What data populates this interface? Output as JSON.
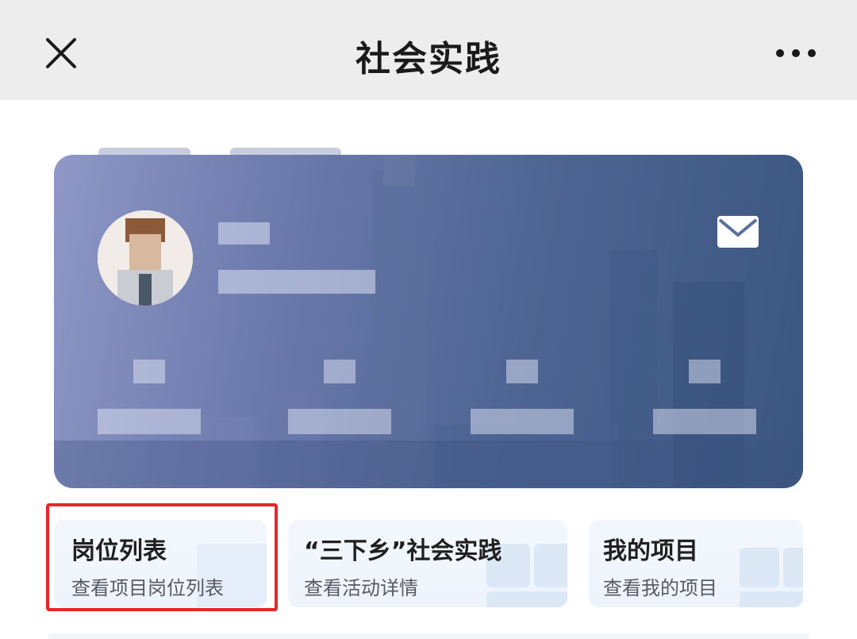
{
  "navbar": {
    "title": "社会实践",
    "close_icon": "close-icon",
    "more_icon": "more-dots-icon"
  },
  "banner": {
    "mail_icon": "envelope-icon",
    "colors": {
      "gradient_start": "#8f98c6",
      "gradient_end": "#3a5680"
    }
  },
  "quick_cards": [
    {
      "title": "岗位列表",
      "subtitle": "查看项目岗位列表"
    },
    {
      "title": "“三下乡”社会实践",
      "subtitle": "查看活动详情"
    },
    {
      "title": "我的项目",
      "subtitle": "查看我的项目"
    }
  ],
  "highlight_color": "#e8252b"
}
